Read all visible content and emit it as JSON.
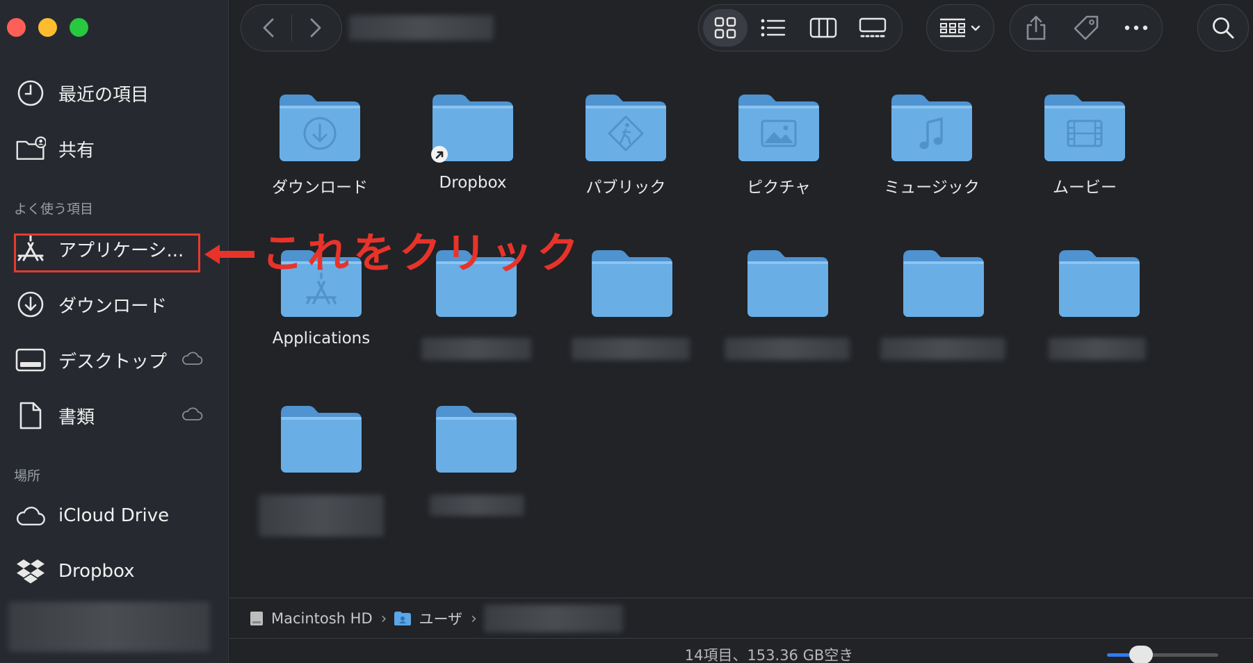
{
  "sidebar": {
    "items_top": [
      {
        "label": "最近の項目",
        "icon": "clock-icon"
      },
      {
        "label": "共有",
        "icon": "shared-folder-icon"
      }
    ],
    "favorites_header": "よく使う項目",
    "favorites": [
      {
        "label": "アプリケーシ...",
        "icon": "applications-icon"
      },
      {
        "label": "ダウンロード",
        "icon": "download-icon"
      },
      {
        "label": "デスクトップ",
        "icon": "desktop-icon"
      },
      {
        "label": "書類",
        "icon": "document-icon"
      }
    ],
    "locations_header": "場所",
    "locations": [
      {
        "label": "iCloud Drive",
        "icon": "icloud-icon"
      },
      {
        "label": "Dropbox",
        "icon": "dropbox-icon"
      }
    ]
  },
  "annotation": {
    "text": "これをクリック",
    "color": "#e8332a"
  },
  "folders": [
    {
      "name": "ダウンロード",
      "glyph": "download"
    },
    {
      "name": "Dropbox",
      "glyph": "alias"
    },
    {
      "name": "パブリック",
      "glyph": "public"
    },
    {
      "name": "ピクチャ",
      "glyph": "picture"
    },
    {
      "name": "ミュージック",
      "glyph": "music"
    },
    {
      "name": "ムービー",
      "glyph": "movie"
    },
    {
      "name": "Applications",
      "glyph": "apps"
    }
  ],
  "pathbar": {
    "disk": "Macintosh HD",
    "users": "ユーザ"
  },
  "status": {
    "text": "14項目、153.36 GB空き"
  },
  "colors": {
    "folder": "#6aaee6",
    "accent": "#2f7bf5"
  }
}
